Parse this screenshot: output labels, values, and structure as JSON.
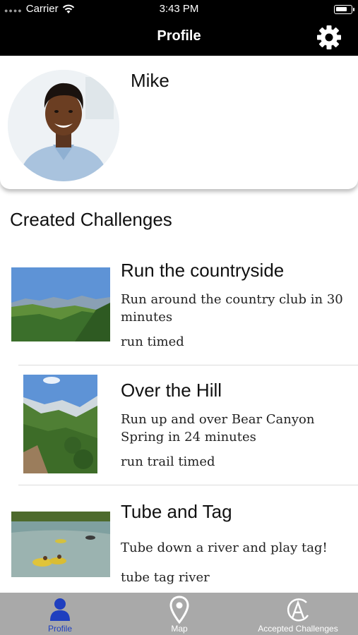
{
  "status_bar": {
    "carrier": "Carrier",
    "time": "3:43 PM",
    "battery_level": 0.8
  },
  "nav": {
    "title": "Profile",
    "settings_icon": "gear-icon"
  },
  "profile": {
    "name": "Mike"
  },
  "section_title": "Created Challenges",
  "challenges": [
    {
      "title": "Run the countryside",
      "description": "Run around the country club in 30 minutes",
      "tags": "run timed"
    },
    {
      "title": "Over the Hill",
      "description": "Run up and over Bear Canyon Spring in 24 minutes",
      "tags": "run trail timed"
    },
    {
      "title": "Tube and Tag",
      "description": "Tube down a river and play tag!",
      "tags": "tube tag river"
    }
  ],
  "tabs": [
    {
      "label": "Profile",
      "icon": "person-icon",
      "active": true
    },
    {
      "label": "Map",
      "icon": "map-pin-icon",
      "active": false
    },
    {
      "label": "Accepted Challenges",
      "icon": "accepted-challenges-icon",
      "active": false
    }
  ],
  "colors": {
    "nav_background": "#000000",
    "tab_bar": "#a9a9a9",
    "active_tab": "#1f3fbf",
    "inactive_tab": "#ffffff"
  }
}
